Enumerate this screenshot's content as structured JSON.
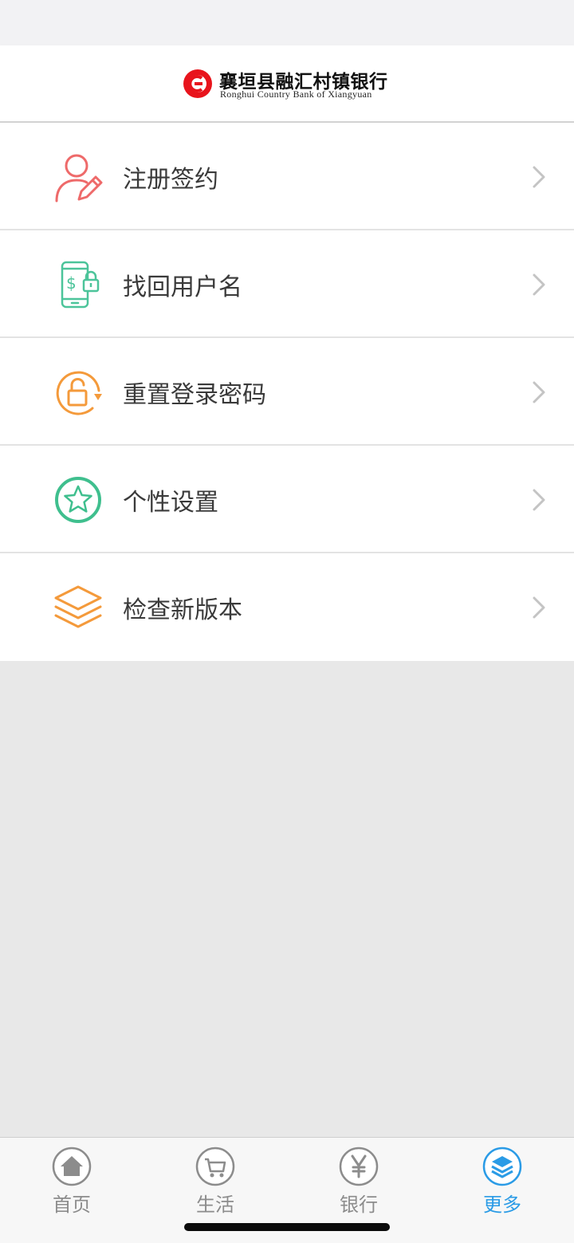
{
  "header": {
    "bank_name_cn": "襄垣县融汇村镇银行",
    "bank_name_en": "Ronghui Country Bank of Xiangyuan",
    "brand_color": "#e8141c"
  },
  "menu": {
    "items": [
      {
        "label": "注册签约",
        "icon": "user-edit-icon",
        "color": "#ee6a6a"
      },
      {
        "label": "找回用户名",
        "icon": "phone-lock-icon",
        "color": "#4cc49a"
      },
      {
        "label": "重置登录密码",
        "icon": "lock-refresh-icon",
        "color": "#f49a3b"
      },
      {
        "label": "个性设置",
        "icon": "star-icon",
        "color": "#3fbf8e"
      },
      {
        "label": "检查新版本",
        "icon": "layers-icon",
        "color": "#f49a3b"
      }
    ]
  },
  "tabbar": {
    "tabs": [
      {
        "label": "首页",
        "icon": "home-icon",
        "active": false
      },
      {
        "label": "生活",
        "icon": "cart-icon",
        "active": false
      },
      {
        "label": "银行",
        "icon": "yen-icon",
        "active": false
      },
      {
        "label": "更多",
        "icon": "layers-icon",
        "active": true
      }
    ],
    "active_color": "#2a9be6",
    "inactive_color": "#8c8c8c"
  }
}
